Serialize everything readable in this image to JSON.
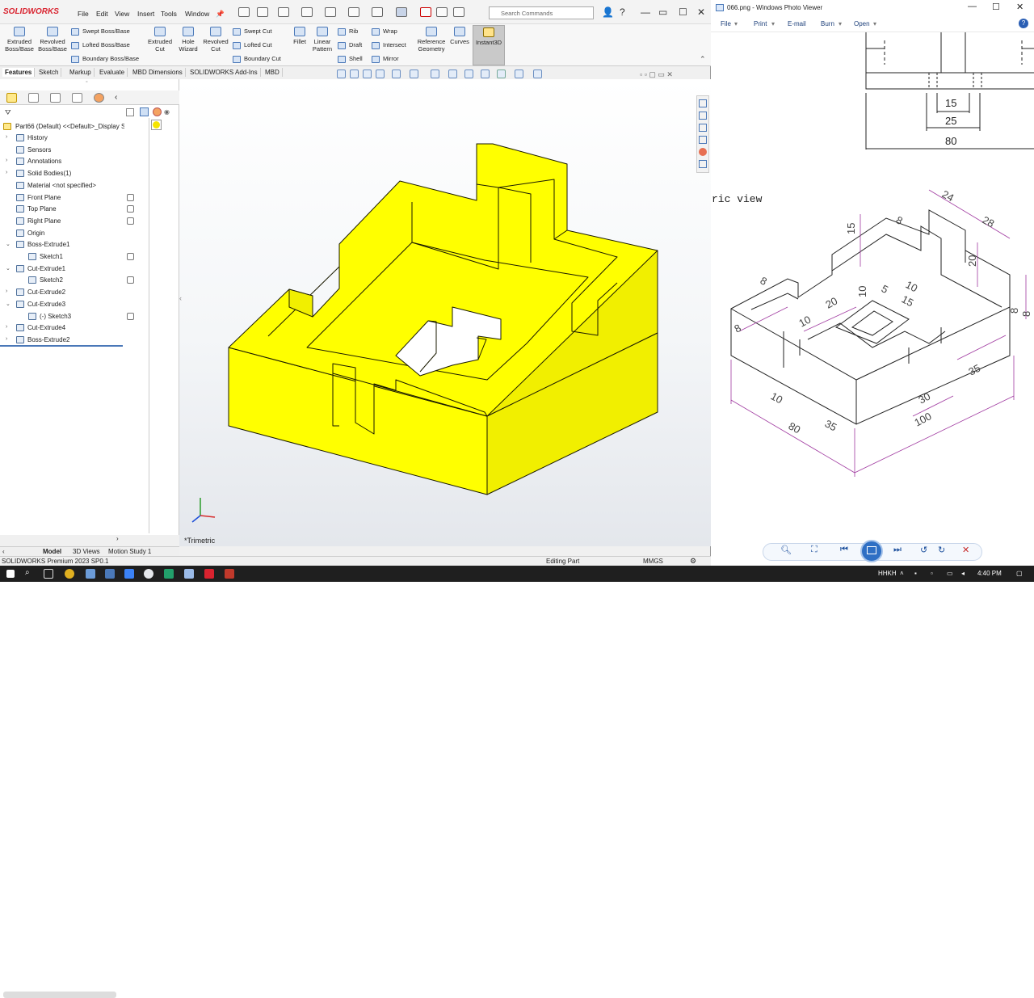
{
  "solidworks": {
    "logo": "SOLIDWORKS",
    "menus": [
      "File",
      "Edit",
      "View",
      "Insert",
      "Tools",
      "Window"
    ],
    "search_placeholder": "Search Commands",
    "ribbon": {
      "extruded_boss": "Extruded Boss/Base",
      "revolved_boss": "Revolved Boss/Base",
      "swept_boss": "Swept Boss/Base",
      "lofted_boss": "Lofted Boss/Base",
      "boundary_boss": "Boundary Boss/Base",
      "extruded_cut": "Extruded Cut",
      "hole_wizard": "Hole Wizard",
      "revolved_cut": "Revolved Cut",
      "swept_cut": "Swept Cut",
      "lofted_cut": "Lofted Cut",
      "boundary_cut": "Boundary Cut",
      "fillet": "Fillet",
      "linear_pattern": "Linear Pattern",
      "rib": "Rib",
      "draft": "Draft",
      "shell": "Shell",
      "wrap": "Wrap",
      "intersect": "Intersect",
      "mirror": "Mirror",
      "reference_geometry": "Reference Geometry",
      "curves": "Curves",
      "instant3d": "Instant3D"
    },
    "command_tabs": [
      "Features",
      "Sketch",
      "Markup",
      "Evaluate",
      "MBD Dimensions",
      "SOLIDWORKS Add-Ins",
      "MBD"
    ],
    "tree": {
      "part_name": "Part66 (Default) <<Default>_Display S",
      "items": [
        {
          "label": "History"
        },
        {
          "label": "Sensors"
        },
        {
          "label": "Annotations"
        },
        {
          "label": "Solid Bodies(1)"
        },
        {
          "label": "Material <not specified>"
        },
        {
          "label": "Front Plane"
        },
        {
          "label": "Top Plane"
        },
        {
          "label": "Right Plane"
        },
        {
          "label": "Origin"
        },
        {
          "label": "Boss-Extrude1"
        },
        {
          "label": "Sketch1"
        },
        {
          "label": "Cut-Extrude1"
        },
        {
          "label": "Sketch2"
        },
        {
          "label": "Cut-Extrude2"
        },
        {
          "label": "Cut-Extrude3"
        },
        {
          "label": "(-) Sketch3"
        },
        {
          "label": "Cut-Extrude4"
        },
        {
          "label": "Boss-Extrude2"
        }
      ]
    },
    "view_label": "*Trimetric",
    "bottom_tabs": [
      "Model",
      "3D Views",
      "Motion Study 1"
    ],
    "status": {
      "version": "SOLIDWORKS Premium 2023 SP0.1",
      "mode": "Editing Part",
      "units": "MMGS"
    },
    "part_color": "#ffff00"
  },
  "photo_viewer": {
    "title": "066.png - Windows Photo Viewer",
    "menus": [
      "File",
      "Print",
      "E-mail",
      "Burn",
      "Open"
    ],
    "drawing": {
      "caption": "ric view",
      "top_dims": [
        "15",
        "25",
        "80"
      ],
      "iso_dims": [
        "24",
        "8",
        "28",
        "15",
        "20",
        "8",
        "10",
        "5",
        "10",
        "15",
        "20",
        "10",
        "8",
        "8",
        "10",
        "80",
        "35",
        "30",
        "100",
        "35",
        "8"
      ]
    }
  },
  "taskbar": {
    "lang": "HHKH",
    "time": "4:40 PM"
  }
}
